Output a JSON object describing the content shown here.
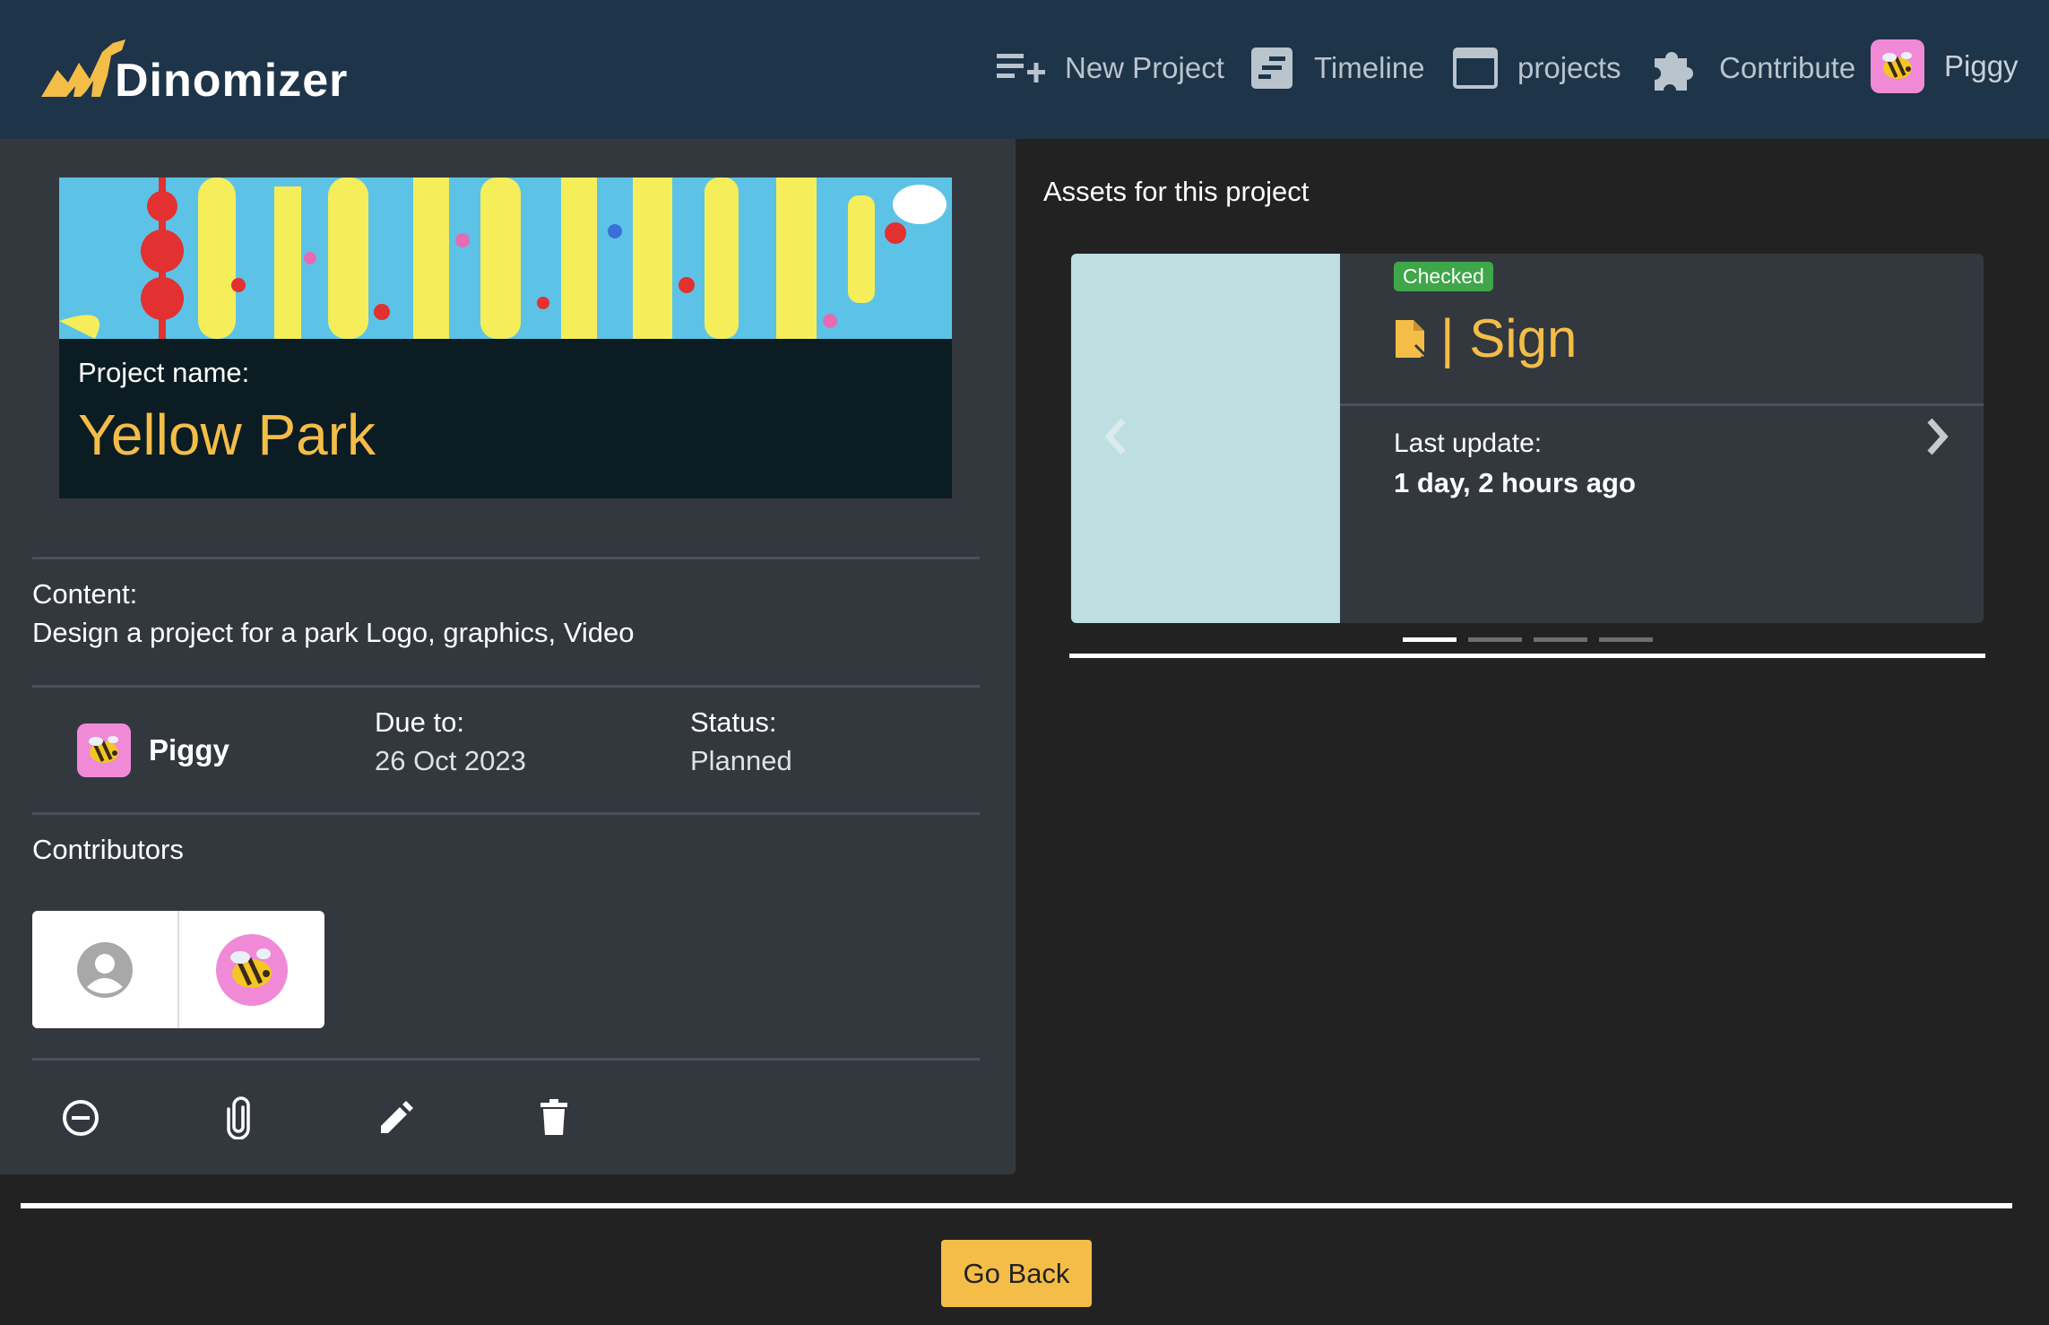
{
  "app": {
    "name": "Dinomizer",
    "colors": {
      "navbar": "#1d3449",
      "accent": "#f4bd48",
      "panel": "#33383f",
      "background": "#222222",
      "badge": "#3fa64a"
    }
  },
  "nav": {
    "new_project": "New Project",
    "timeline": "Timeline",
    "projects": "projects",
    "contribute": "Contribute",
    "user": "Piggy"
  },
  "project": {
    "name_label": "Project name:",
    "name": "Yellow Park",
    "content_label": "Content:",
    "content": "Design a project for a park Logo, graphics, Video",
    "owner": "Piggy",
    "due_label": "Due to:",
    "due": "26 Oct 2023",
    "status_label": "Status:",
    "status": "Planned",
    "contributors_label": "Contributors"
  },
  "actions": [
    "minus-circle-icon",
    "paperclip-icon",
    "pencil-icon",
    "trash-icon"
  ],
  "assets": {
    "title": "Assets for this project",
    "current": {
      "badge": "Checked",
      "title": "| Sign",
      "update_label": "Last update:",
      "update_value": "1 day, 2 hours ago"
    },
    "slide_count": 4,
    "active_slide": 1
  },
  "footer": {
    "go_back": "Go Back"
  }
}
